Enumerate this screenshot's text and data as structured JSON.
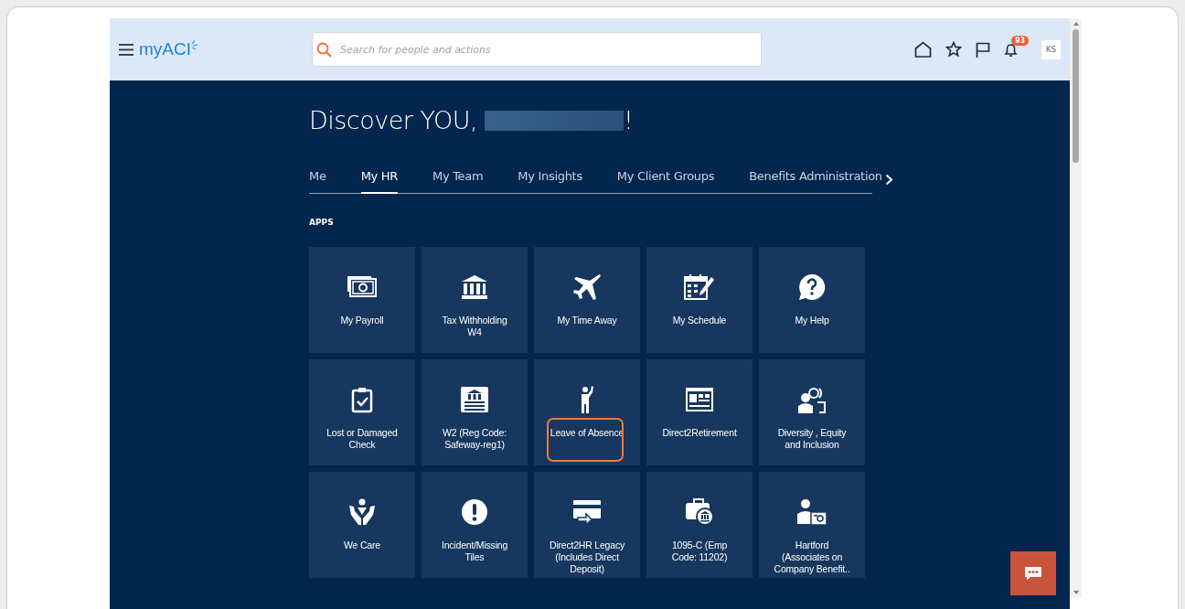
{
  "header": {
    "logo": "myACI",
    "search": {
      "placeholder": "Search for people and actions"
    },
    "notifications": {
      "count": "93"
    },
    "avatar": "KS"
  },
  "greeting": {
    "text": "Discover YOU,",
    "end": "!"
  },
  "tabs": [
    {
      "label": "Me",
      "selected": false
    },
    {
      "label": "My HR",
      "selected": true
    },
    {
      "label": "My Team",
      "selected": false
    },
    {
      "label": "My Insights",
      "selected": false
    },
    {
      "label": "My Client Groups",
      "selected": false
    },
    {
      "label": "Benefits Administration",
      "selected": false
    }
  ],
  "section_title": "APPS",
  "tiles": [
    {
      "label": "My Payroll",
      "highlighted": false
    },
    {
      "label": "Tax Withholding W4",
      "highlighted": false
    },
    {
      "label": "My Time Away",
      "highlighted": false
    },
    {
      "label": "My Schedule",
      "highlighted": false
    },
    {
      "label": "My Help",
      "highlighted": false
    },
    {
      "label": "Lost or Damaged Check",
      "highlighted": false
    },
    {
      "label": "W2 (Reg Code: Safeway-reg1)",
      "highlighted": false
    },
    {
      "label": "Leave of Absence",
      "highlighted": true
    },
    {
      "label": "Direct2Retirement",
      "highlighted": false
    },
    {
      "label": "Diversity , Equity and Inclusion",
      "highlighted": false
    },
    {
      "label": "We Care",
      "highlighted": false
    },
    {
      "label": "Incident/Missing Tiles",
      "highlighted": false
    },
    {
      "label": "Direct2HR Legacy (Includes Direct Deposit)",
      "highlighted": false
    },
    {
      "label": "1095-C (Emp Code: 11202)",
      "highlighted": false
    },
    {
      "label": "Hartford (Associates on Company Benefit..",
      "highlighted": false
    }
  ]
}
